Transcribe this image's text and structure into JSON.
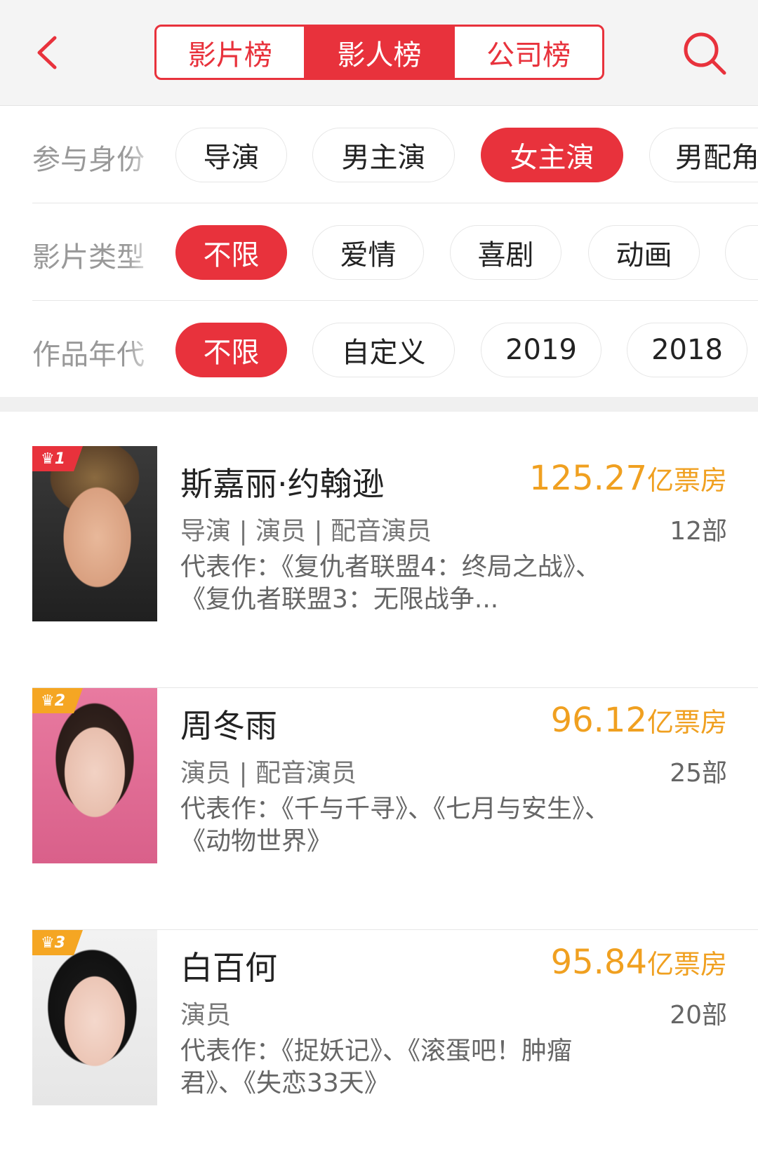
{
  "header": {
    "tabs": [
      {
        "label": "影片榜",
        "active": false
      },
      {
        "label": "影人榜",
        "active": true
      },
      {
        "label": "公司榜",
        "active": false
      }
    ],
    "back_icon": "chevron-left-icon",
    "search_icon": "search-icon"
  },
  "filters": [
    {
      "label": "参与身份",
      "chips": [
        {
          "label": "导演"
        },
        {
          "label": "男主演"
        },
        {
          "label": "女主演",
          "active": true
        },
        {
          "label": "男配角"
        }
      ]
    },
    {
      "label": "影片类型",
      "chips": [
        {
          "label": "不限",
          "active": true
        },
        {
          "label": "爱情"
        },
        {
          "label": "喜剧"
        },
        {
          "label": "动画"
        },
        {
          "label": ""
        }
      ]
    },
    {
      "label": "作品年代",
      "chips": [
        {
          "label": "不限",
          "active": true
        },
        {
          "label": "自定义"
        },
        {
          "label": "2019"
        },
        {
          "label": "2018"
        }
      ]
    }
  ],
  "colors": {
    "accent": "#e8323c",
    "gold": "#f0a020",
    "rank1": "#e8323c",
    "rank23": "#f5a623"
  },
  "list": [
    {
      "rank": "1",
      "name": "斯嘉丽·约翰逊",
      "box": "125.27",
      "unit": "亿票房",
      "roles": "导演 | 演员 | 配音演员",
      "count": "12部",
      "works": "代表作：《复仇者联盟4：终局之战》、《复仇者联盟3：无限战争..."
    },
    {
      "rank": "2",
      "name": "周冬雨",
      "box": "96.12",
      "unit": "亿票房",
      "roles": "演员 | 配音演员",
      "count": "25部",
      "works": "代表作：《千与千寻》、《七月与安生》、《动物世界》"
    },
    {
      "rank": "3",
      "name": "白百何",
      "box": "95.84",
      "unit": "亿票房",
      "roles": "演员",
      "count": "20部",
      "works": "代表作：《捉妖记》、《滚蛋吧！肿瘤君》、《失恋33天》"
    }
  ]
}
